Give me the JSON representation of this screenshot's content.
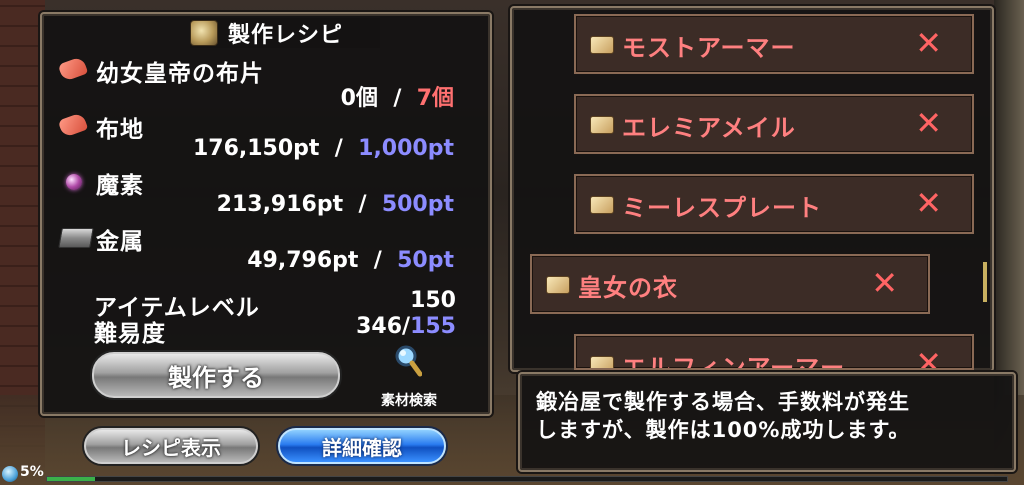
{
  "recipe_panel": {
    "title": "製作レシピ",
    "materials": [
      {
        "name": "幼女皇帝の布片",
        "icon": "cloth-icon",
        "have": "0個",
        "sep": "/",
        "need": "7個",
        "need_color": "#ff7070"
      },
      {
        "name": "布地",
        "icon": "cloth-icon",
        "have": "176,150pt",
        "sep": "/",
        "need": "1,000pt",
        "need_color": "#8c8cff"
      },
      {
        "name": "魔素",
        "icon": "magic-orb-icon",
        "have": "213,916pt",
        "sep": "/",
        "need": "500pt",
        "need_color": "#8c8cff"
      },
      {
        "name": "金属",
        "icon": "metal-ingot-icon",
        "have": "49,796pt",
        "sep": "/",
        "need": "50pt",
        "need_color": "#8c8cff"
      }
    ],
    "item_level_label": "アイテムレベル",
    "item_level_value": "150",
    "difficulty_label": "難易度",
    "difficulty_value": "346/",
    "difficulty_max": "155",
    "craft_button": "製作する",
    "search_label": "素材検索"
  },
  "bottom_buttons": {
    "recipe_display": "レシピ表示",
    "details": "詳細確認"
  },
  "recipe_list": [
    {
      "name": "モストアーマー",
      "close": "✕"
    },
    {
      "name": "エレミアメイル",
      "close": "✕"
    },
    {
      "name": "ミーレスプレート",
      "close": "✕"
    },
    {
      "name": "皇女の衣",
      "close": "✕"
    },
    {
      "name": "エルフィンアーマー",
      "close": "✕"
    }
  ],
  "message": {
    "line1": "鍛冶屋で製作する場合、手数料が発生",
    "line2": "しますが、製作は100%成功します。"
  },
  "status": {
    "text": "5%",
    "exp_fraction": 0.05
  }
}
